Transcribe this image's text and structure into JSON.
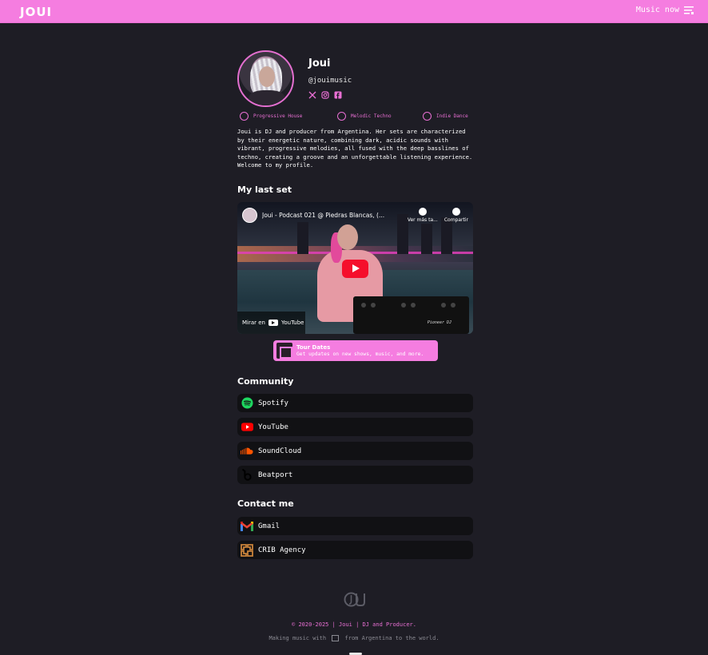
{
  "header": {
    "logo": "JOUI",
    "nav_label": "Music now",
    "bg_color": "#f57de0"
  },
  "profile": {
    "name": "Joui",
    "handle": "@jouimusic",
    "socials": [
      {
        "icon": "x-icon"
      },
      {
        "icon": "instagram-icon"
      },
      {
        "icon": "facebook-icon"
      }
    ],
    "tags": [
      "Progressive House",
      "Melodic Techno",
      "Indie Dance"
    ],
    "bio": "Joui is DJ and producer from Argentina. Her sets are characterized by their energetic nature, combining dark, acidic sounds with vibrant, progressive melodies, all fused with the deep basslines of techno, creating a groove and an unforgettable listening experience. Welcome to my profile."
  },
  "last_set": {
    "section_title": "My last set",
    "video_title": "Joui - Podcast 021 @ Piedras Blancas, (...",
    "watch_later": "Ver más ta...",
    "share": "Compartir",
    "watch_on": "Mirar en",
    "watch_on_brand": "YouTube",
    "deck_brand": "Pioneer DJ"
  },
  "tour": {
    "title": "Tour Dates",
    "subtitle": "Get updates on new shows, music, and more."
  },
  "community": {
    "section_title": "Community",
    "links": [
      {
        "label": "Spotify",
        "icon": "spotify-icon",
        "color": "#1ed760"
      },
      {
        "label": "YouTube",
        "icon": "youtube-icon",
        "color": "#ff0000"
      },
      {
        "label": "SoundCloud",
        "icon": "soundcloud-icon",
        "color": "#ff5500"
      },
      {
        "label": "Beatport",
        "icon": "beatport-icon",
        "color": "#000000"
      }
    ]
  },
  "contact": {
    "section_title": "Contact me",
    "links": [
      {
        "label": "Gmail",
        "icon": "gmail-icon"
      },
      {
        "label": "CRIB Agency",
        "icon": "crib-agency-icon",
        "color": "#c9833a"
      }
    ]
  },
  "footer": {
    "copyright": "© 2020-2025 | Joui | DJ and Producer.",
    "made_prefix": "Making music with",
    "made_suffix": "from Argentina to the world."
  }
}
